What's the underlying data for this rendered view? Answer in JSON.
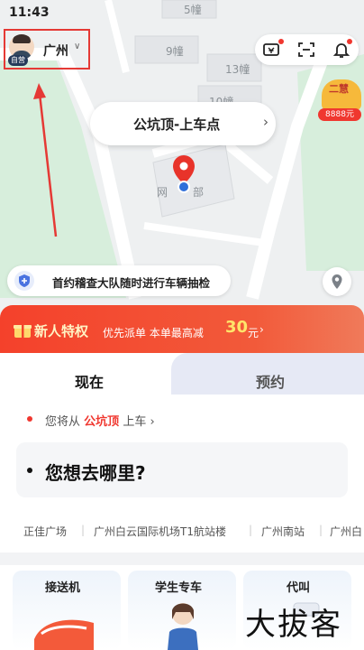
{
  "status_bar": {
    "time": "11:43"
  },
  "map": {
    "labels": [
      "5幢",
      "9幢",
      "13幢",
      "10幢",
      "网",
      "部"
    ]
  },
  "header": {
    "auth_badge": "自营",
    "city": "广州",
    "city_chevron": "∨"
  },
  "top_actions": {
    "icons": [
      "ticket-icon",
      "scan-icon",
      "bell-icon"
    ]
  },
  "promo_float": {
    "title": "二慧",
    "price": "8888元"
  },
  "pickup": {
    "label": "公坑顶-上车点",
    "chevron": "›"
  },
  "notice": {
    "text": "首约稽查大队随时进行车辆抽检"
  },
  "banner": {
    "title": "新人特权",
    "subtitle": "优先派单 本单最高减",
    "amount": "30",
    "unit": "元",
    "arrow": "›"
  },
  "tabs": [
    {
      "label": "现在"
    },
    {
      "label": "预约"
    }
  ],
  "from": {
    "prefix": "您将从",
    "place": "公坑顶",
    "suffix": "上车",
    "chevron": "›"
  },
  "destination": {
    "placeholder": "您想去哪里?"
  },
  "quick_places": [
    "正佳广场",
    "广州白云国际机场T1航站楼",
    "广州南站",
    "广州白"
  ],
  "services": [
    "接送机",
    "学生专车",
    "代叫"
  ],
  "watermark": "大拔客",
  "colors": {
    "accent_red": "#f0372f",
    "banner_red": "#f4412b",
    "pin_red": "#e8332a",
    "blue_dot": "#2f6fd9"
  }
}
